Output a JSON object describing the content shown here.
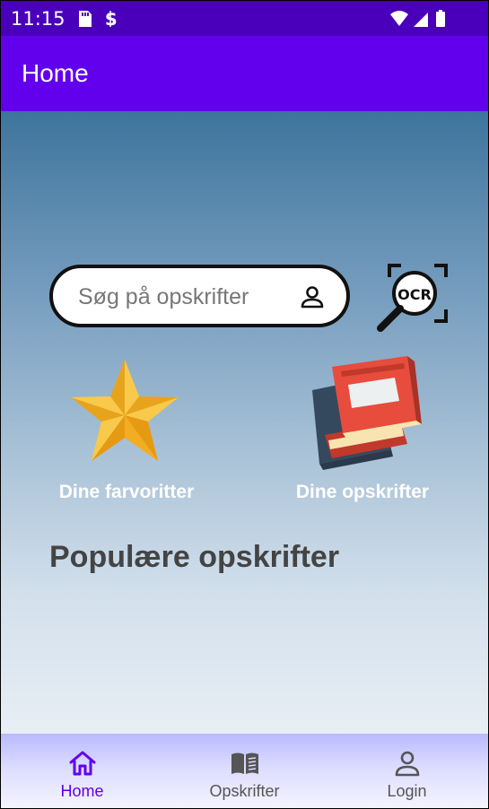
{
  "status_bar": {
    "time": "11:15"
  },
  "app_bar": {
    "title": "Home"
  },
  "search": {
    "placeholder": "Søg på opskrifter"
  },
  "ocr": {
    "label": "OCR"
  },
  "shortcuts": [
    {
      "label": "Dine farvoritter",
      "icon": "star-icon"
    },
    {
      "label": "Dine opskrifter",
      "icon": "books-icon"
    }
  ],
  "sections": {
    "popular_title": "Populære opskrifter"
  },
  "bottom_nav": {
    "items": [
      {
        "label": "Home",
        "icon": "home-icon",
        "active": true
      },
      {
        "label": "Opskrifter",
        "icon": "open-book-icon",
        "active": false
      },
      {
        "label": "Login",
        "icon": "person-icon",
        "active": false
      }
    ]
  },
  "colors": {
    "status_bar": "#4a00bb",
    "app_bar": "#6200ee",
    "accent": "#6200ee",
    "section_title": "#444444"
  }
}
